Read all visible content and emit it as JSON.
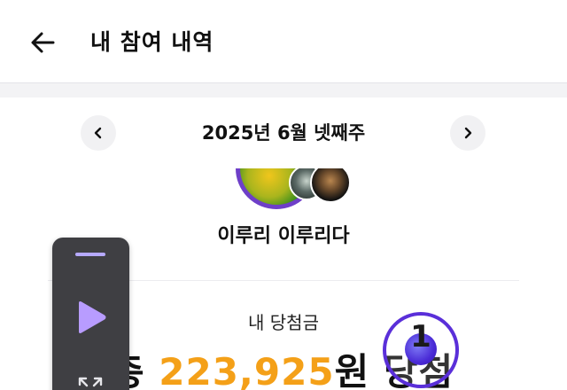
{
  "header": {
    "title": "내 참여 내역",
    "back_icon": "arrow-left-icon"
  },
  "week_nav": {
    "label": "2025년 6월 넷째주",
    "prev_icon": "chevron-left-icon",
    "next_icon": "chevron-right-icon"
  },
  "artist": {
    "name": "이루리 이루리다"
  },
  "prize": {
    "label": "내 당첨금",
    "prefix": "총 ",
    "amount": "223,925",
    "suffix": "원 당첨"
  },
  "rank": {
    "value": "1"
  },
  "floating_player": {
    "play_icon": "play-icon",
    "expand_icon": "expand-icon"
  },
  "colors": {
    "accent_purple": "#5a2fd9",
    "amount_orange": "#f4a018",
    "play_purple": "#b89cff"
  }
}
